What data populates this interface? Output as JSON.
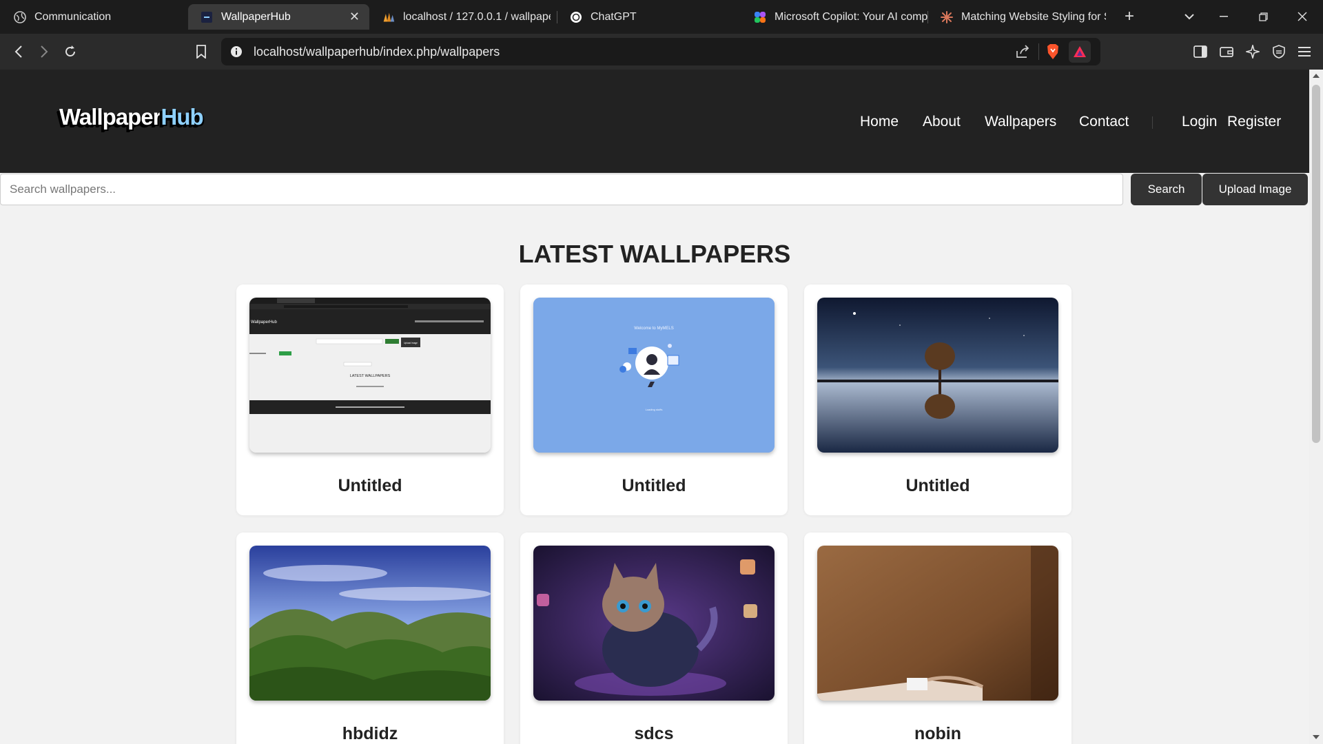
{
  "browser": {
    "tabs": [
      {
        "title": "Communication",
        "icon": "globe-icon",
        "active": false
      },
      {
        "title": "WallpaperHub",
        "icon": "site-favicon",
        "active": true
      },
      {
        "title": "localhost / 127.0.0.1 / wallpape",
        "icon": "phpmyadmin-icon",
        "active": false
      },
      {
        "title": "ChatGPT",
        "icon": "chatgpt-icon",
        "active": false
      },
      {
        "title": "Microsoft Copilot: Your AI comp",
        "icon": "copilot-icon",
        "active": false
      },
      {
        "title": "Matching Website Styling for Se",
        "icon": "claude-icon",
        "active": false
      }
    ],
    "new_tab": "+",
    "close_tab": "✕",
    "url": "localhost/wallpaperhub/index.php/wallpapers"
  },
  "site": {
    "logo_main": "Wallpaper",
    "logo_accent": "Hub",
    "nav": [
      "Home",
      "About",
      "Wallpapers",
      "Contact"
    ],
    "auth": [
      "Login",
      "Register"
    ],
    "search": {
      "placeholder": "Search wallpapers...",
      "search_button": "Search",
      "upload_button": "Upload Image"
    },
    "section_title": "LATEST WALLPAPERS",
    "wallpapers": [
      {
        "title": "Untitled",
        "image": "website-screenshot"
      },
      {
        "title": "Untitled",
        "image": "blue-illustration"
      },
      {
        "title": "Untitled",
        "image": "tree-reflection-night"
      },
      {
        "title": "hbdidz",
        "image": "green-mountains"
      },
      {
        "title": "sdcs",
        "image": "kitten-in-jacket"
      },
      {
        "title": "nobin",
        "image": "brown-desk-hand"
      }
    ],
    "mini_preview": {
      "logo": "WallpaperHub",
      "heading": "LATEST WALLPAPERS",
      "upload": "Upload Image",
      "search": "Search"
    },
    "mini_illustration": {
      "title": "Welcome to MyMELS",
      "loading": "Loading stuffs"
    }
  },
  "colors": {
    "header_bg": "#222222",
    "page_bg": "#f2f2f2",
    "button_bg": "#333333",
    "logo_accent": "#8ed0ff"
  }
}
